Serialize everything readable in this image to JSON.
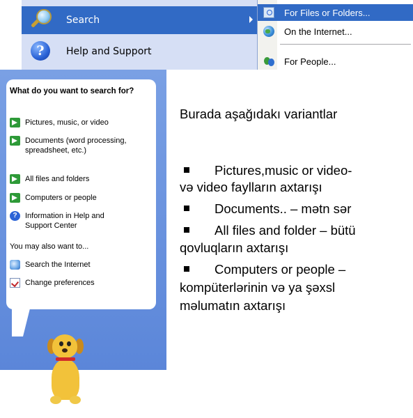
{
  "start_menu": {
    "items": [
      {
        "label": "Search",
        "icon": "search-icon",
        "highlighted": true,
        "has_submenu": true
      },
      {
        "label": "Help and Support",
        "icon": "help-icon",
        "highlighted": false
      }
    ]
  },
  "search_submenu": {
    "items": [
      {
        "label": "For Files or Folders...",
        "icon": "folder-search-icon",
        "highlighted": true
      },
      {
        "label": "On the Internet...",
        "icon": "globe-icon",
        "highlighted": false
      },
      {
        "label": "For People...",
        "icon": "people-icon",
        "highlighted": false
      }
    ]
  },
  "search_companion": {
    "title": "What do you want to search for?",
    "options": [
      {
        "label": "Pictures, music, or video",
        "icon": "green-arrow-icon"
      },
      {
        "label": "Documents (word processing, spreadsheet, etc.)",
        "icon": "green-arrow-icon"
      },
      {
        "label": "All files and folders",
        "icon": "green-arrow-icon"
      },
      {
        "label": "Computers or people",
        "icon": "green-arrow-icon"
      },
      {
        "label": "Information in Help and Support Center",
        "icon": "help-icon"
      }
    ],
    "also_label": "You may also want to...",
    "extra_options": [
      {
        "label": "Search the Internet",
        "icon": "search-web-icon"
      },
      {
        "label": "Change preferences",
        "icon": "preferences-icon"
      }
    ],
    "mascot": "search-dog-icon"
  },
  "explanation": {
    "intro": "Burada aşağıdakı variantlar",
    "lines": [
      {
        "text": "Pictures,music or video-",
        "bullet": true
      },
      {
        "text": "və video faylların axtarışı",
        "bullet": false
      },
      {
        "text": "Documents.. – mətn sər",
        "bullet": true
      },
      {
        "text": "All files and folder – bütü",
        "bullet": true
      },
      {
        "text": "qovluqların axtarışı",
        "bullet": false
      },
      {
        "text": "Computers or people –",
        "bullet": true
      },
      {
        "text": "kompüterlərinin və ya şəxsl",
        "bullet": false
      },
      {
        "text": "məlumatın axtarışı",
        "bullet": false
      }
    ]
  },
  "colors": {
    "menu_highlight": "#316ac5",
    "start_menu_bg": "#d6dff5",
    "companion_pane_bg": "#6b94dd",
    "arrow_green": "#2e9a38"
  }
}
